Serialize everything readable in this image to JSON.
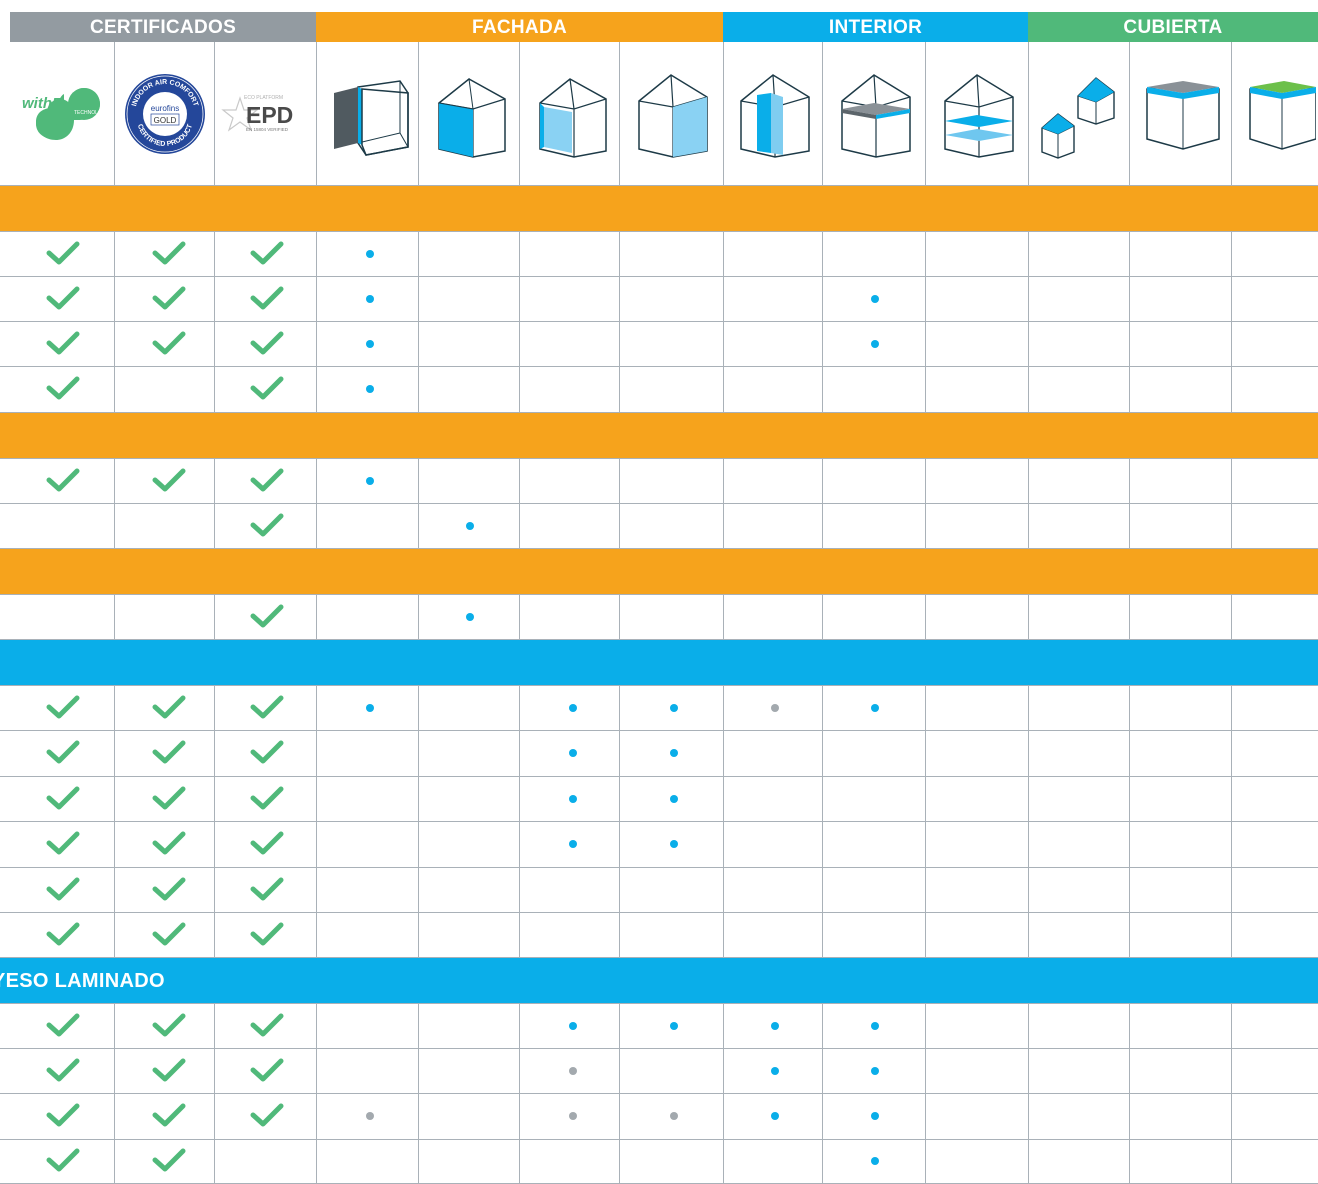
{
  "header_bands": [
    {
      "label": "CERTIFICADOS",
      "color": "#939ba1",
      "cols": [
        0,
        2
      ]
    },
    {
      "label": "FACHADA",
      "color": "#f6a31c",
      "cols": [
        3,
        6
      ]
    },
    {
      "label": "INTERIOR",
      "color": "#0aaee9",
      "cols": [
        7,
        9
      ]
    },
    {
      "label": "CUBIERTA",
      "color": "#50b97a",
      "cols": [
        10,
        12
      ]
    }
  ],
  "certificates": [
    {
      "name": "withe-technology-logo",
      "brand": "withE",
      "sub": "TECHNOLOGY"
    },
    {
      "name": "eurofins-gold-seal",
      "ring_top": "INDOOR AIR COMFORT",
      "ring_bottom": "CERTIFIED PRODUCT",
      "brand": "eurofins",
      "level": "GOLD"
    },
    {
      "name": "epd-logo",
      "top": "ECO PLATFORM",
      "brand": "EPD",
      "bottom": "EN 15804 VERIFIED"
    }
  ],
  "application_icons": [
    "wall-exterior-side-icon",
    "facade-blue-wall-icon",
    "facade-light-wall-icon",
    "facade-full-gable-icon",
    "interior-partition-icon",
    "interior-ceiling-layer-icon",
    "interior-floor-layers-icon",
    "roof-pitched-houses-icon",
    "roof-flat-grey-icon",
    "roof-flat-green-icon"
  ],
  "colors": {
    "orange": "#f6a31c",
    "blue": "#0aaee9",
    "grey": "#939ba1",
    "green": "#50b97a",
    "dot_blue": "#0aaee9",
    "dot_grey": "#a3a9ae",
    "grid": "#a9b1b8"
  },
  "rows": [
    {
      "type": "section",
      "color": "orange",
      "label": ""
    },
    {
      "type": "data",
      "checks": [
        1,
        1,
        1
      ],
      "dots": {
        "3": "blue"
      }
    },
    {
      "type": "data",
      "checks": [
        1,
        1,
        1
      ],
      "dots": {
        "3": "blue",
        "8": "blue"
      }
    },
    {
      "type": "data",
      "checks": [
        1,
        1,
        1
      ],
      "dots": {
        "3": "blue",
        "8": "blue"
      }
    },
    {
      "type": "data",
      "checks": [
        1,
        0,
        1
      ],
      "dots": {
        "3": "blue"
      }
    },
    {
      "type": "section",
      "color": "orange",
      "label": ""
    },
    {
      "type": "data",
      "checks": [
        1,
        1,
        1
      ],
      "dots": {
        "3": "blue"
      }
    },
    {
      "type": "data",
      "checks": [
        0,
        0,
        1
      ],
      "dots": {
        "4": "blue"
      }
    },
    {
      "type": "section",
      "color": "orange",
      "label": ""
    },
    {
      "type": "data",
      "checks": [
        0,
        0,
        1
      ],
      "dots": {
        "4": "blue"
      }
    },
    {
      "type": "section",
      "color": "blue",
      "label": ""
    },
    {
      "type": "data",
      "checks": [
        1,
        1,
        1
      ],
      "dots": {
        "3": "blue",
        "5": "blue",
        "6": "blue",
        "7": "grey",
        "8": "blue"
      }
    },
    {
      "type": "data",
      "checks": [
        1,
        1,
        1
      ],
      "dots": {
        "5": "blue",
        "6": "blue"
      }
    },
    {
      "type": "data",
      "checks": [
        1,
        1,
        1
      ],
      "dots": {
        "5": "blue",
        "6": "blue"
      }
    },
    {
      "type": "data",
      "checks": [
        1,
        1,
        1
      ],
      "dots": {
        "5": "blue",
        "6": "blue"
      }
    },
    {
      "type": "data",
      "checks": [
        1,
        1,
        1
      ],
      "dots": {}
    },
    {
      "type": "data",
      "checks": [
        1,
        1,
        1
      ],
      "dots": {}
    },
    {
      "type": "section",
      "color": "blue",
      "label": "YESO LAMINADO"
    },
    {
      "type": "data",
      "checks": [
        1,
        1,
        1
      ],
      "dots": {
        "5": "blue",
        "6": "blue",
        "7": "blue",
        "8": "blue"
      }
    },
    {
      "type": "data",
      "checks": [
        1,
        1,
        1
      ],
      "dots": {
        "5": "grey",
        "7": "blue",
        "8": "blue"
      }
    },
    {
      "type": "data",
      "checks": [
        1,
        1,
        1
      ],
      "dots": {
        "3": "grey",
        "5": "grey",
        "6": "grey",
        "7": "blue",
        "8": "blue"
      }
    },
    {
      "type": "data",
      "checks": [
        1,
        1,
        0
      ],
      "dots": {
        "8": "blue"
      }
    }
  ]
}
